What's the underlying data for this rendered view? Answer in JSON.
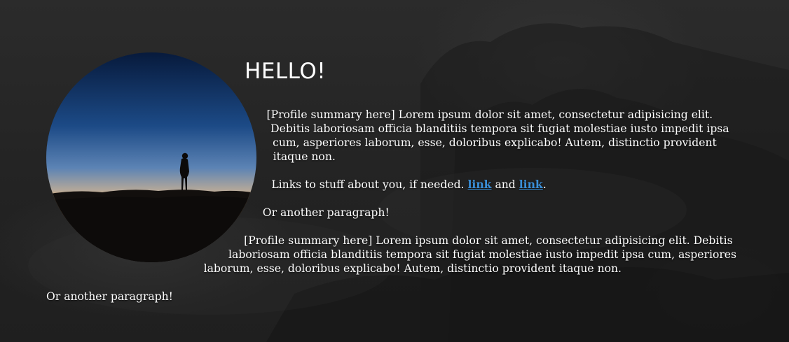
{
  "heading": "HELLO!",
  "paragraph_1": "[Profile summary here] Lorem ipsum dolor sit amet, consectetur adipisicing elit. Debitis laboriosam officia blanditiis tempora sit fugiat molestiae iusto impedit ipsa cum, asperiores laborum, esse, doloribus explicabo! Autem, distinctio provident itaque non.",
  "links_paragraph": {
    "prefix": "Links to stuff about you, if needed. ",
    "link_1": "link",
    "and": " and ",
    "link_2": "link",
    "suffix": "."
  },
  "paragraph_2": "Or another paragraph!",
  "paragraph_3": "[Profile summary here] Lorem ipsum dolor sit amet, consectetur adipisicing elit. Debitis laboriosam officia blanditiis tempora sit fugiat molestiae iusto impedit ipsa cum, asperiores laborum, esse, doloribus explicabo! Autem, distinctio provident itaque non.",
  "paragraph_4": "Or another paragraph!",
  "colors": {
    "background": "#262626",
    "text": "#ffffff",
    "link": "#3a8fd8"
  }
}
